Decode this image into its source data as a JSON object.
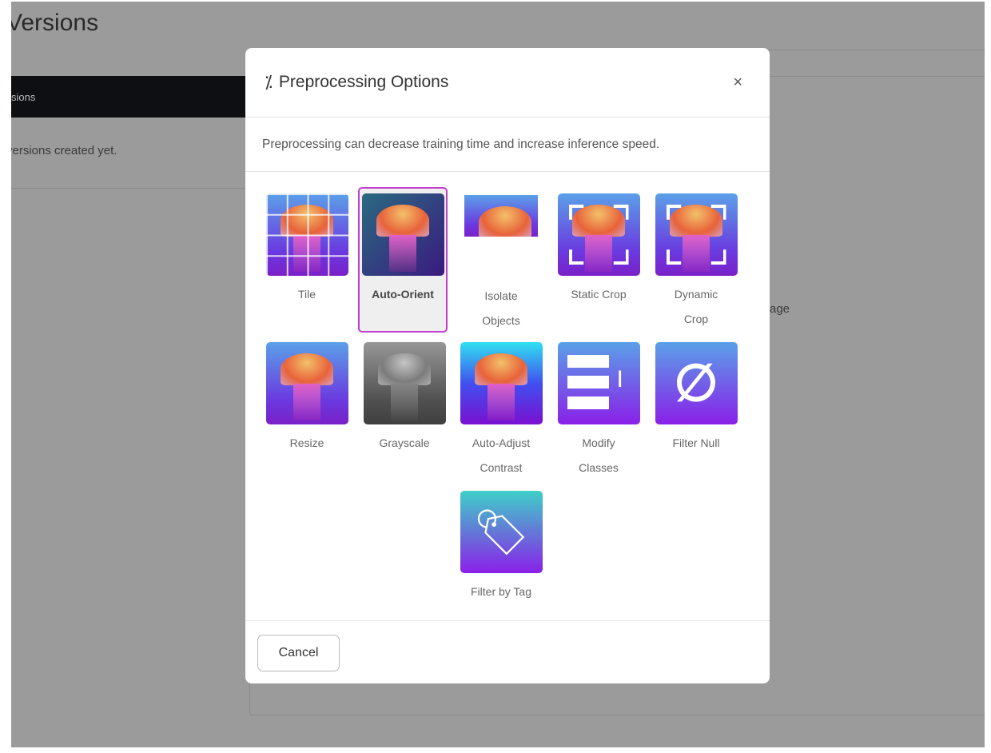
{
  "background": {
    "page_title": "Versions",
    "tab_label": "sions",
    "empty_text": "versions created yet.",
    "right_text": "age"
  },
  "modal": {
    "title": "Preprocessing Options",
    "title_icon": "magic-wand-icon",
    "close_icon": "close-icon",
    "close_glyph": "×",
    "description": "Preprocessing can decrease training time and increase inference speed.",
    "accent_color": "#c23ed1",
    "options": [
      {
        "label": "Tile",
        "selected": false
      },
      {
        "label": "Auto-Orient",
        "selected": true
      },
      {
        "label": "Isolate Objects",
        "selected": false
      },
      {
        "label": "Static Crop",
        "selected": false
      },
      {
        "label": "Dynamic Crop",
        "selected": false
      },
      {
        "label": "Resize",
        "selected": false
      },
      {
        "label": "Grayscale",
        "selected": false
      },
      {
        "label": "Auto-Adjust Contrast",
        "selected": false
      },
      {
        "label": "Modify Classes",
        "selected": false
      },
      {
        "label": "Filter Null",
        "selected": false
      },
      {
        "label": "Filter by Tag",
        "selected": false
      }
    ],
    "cancel_label": "Cancel"
  }
}
